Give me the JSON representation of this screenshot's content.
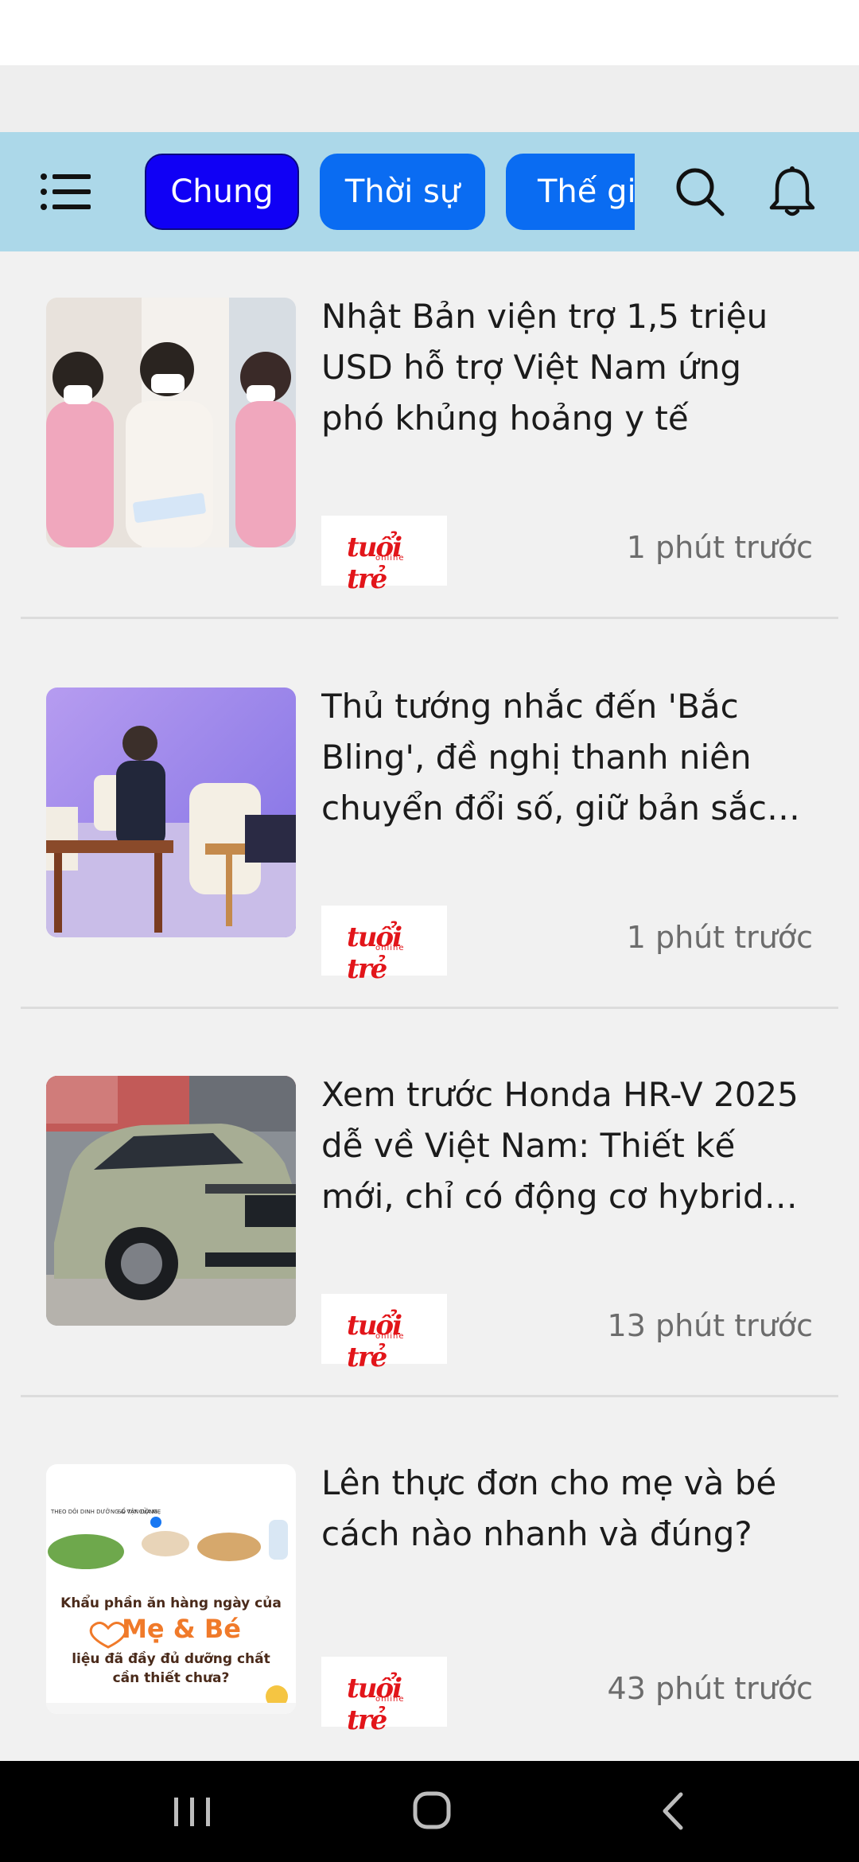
{
  "header": {
    "menu_icon": "hamburger-menu-icon",
    "tabs": [
      {
        "label": "Chung",
        "active": true
      },
      {
        "label": "Thời sự",
        "active": false
      },
      {
        "label": "Thế giới",
        "active": false
      }
    ],
    "search_icon": "search-icon",
    "notification_icon": "bell-icon"
  },
  "articles": [
    {
      "title": "Nhật Bản viện trợ 1,5 triệu USD hỗ trợ Việt Nam ứng phó khủng hoảng y tế",
      "source_logo": "tuổi trẻ",
      "source_logo_sub": "online",
      "time": "1 phút trước"
    },
    {
      "title": "Thủ tướng nhắc đến 'Bắc Bling', đề nghị thanh niên chuyển đổi số, giữ bản sắc văn hóa",
      "source_logo": "tuổi trẻ",
      "source_logo_sub": "online",
      "time": "1 phút trước"
    },
    {
      "title": "Xem trước Honda HR-V 2025 dễ về Việt Nam: Thiết kế mới, chỉ có động cơ hybrid tiết kiệm",
      "source_logo": "tuổi trẻ",
      "source_logo_sub": "online",
      "time": "13 phút trước"
    },
    {
      "title": "Lên thực đơn cho mẹ và bé cách nào nhanh và đúng?",
      "source_logo": "tuổi trẻ",
      "source_logo_sub": "online",
      "time": "43 phút trước",
      "thumb_text": {
        "top_left": "THEO DÕI DINH DƯỠNG & VẬN ĐỘNG",
        "top_mid": "SỔ TAY CỦA MẸ",
        "line1": "Khẩu phần ăn hàng ngày của",
        "brand": "Mẹ & Bé",
        "line2": "liệu đã đầy đủ dưỡng chất",
        "line3": "cần thiết chưa?"
      }
    }
  ],
  "colors": {
    "header_bg": "#acd8e9",
    "tab_bg": "#0a6cf2",
    "tab_active_bg": "#1000f5",
    "logo_red": "#e2151a",
    "page_bg": "#f1f1f1"
  },
  "nav_bar": {
    "recent_icon": "recent-apps-icon",
    "home_icon": "home-icon",
    "back_icon": "back-icon"
  }
}
